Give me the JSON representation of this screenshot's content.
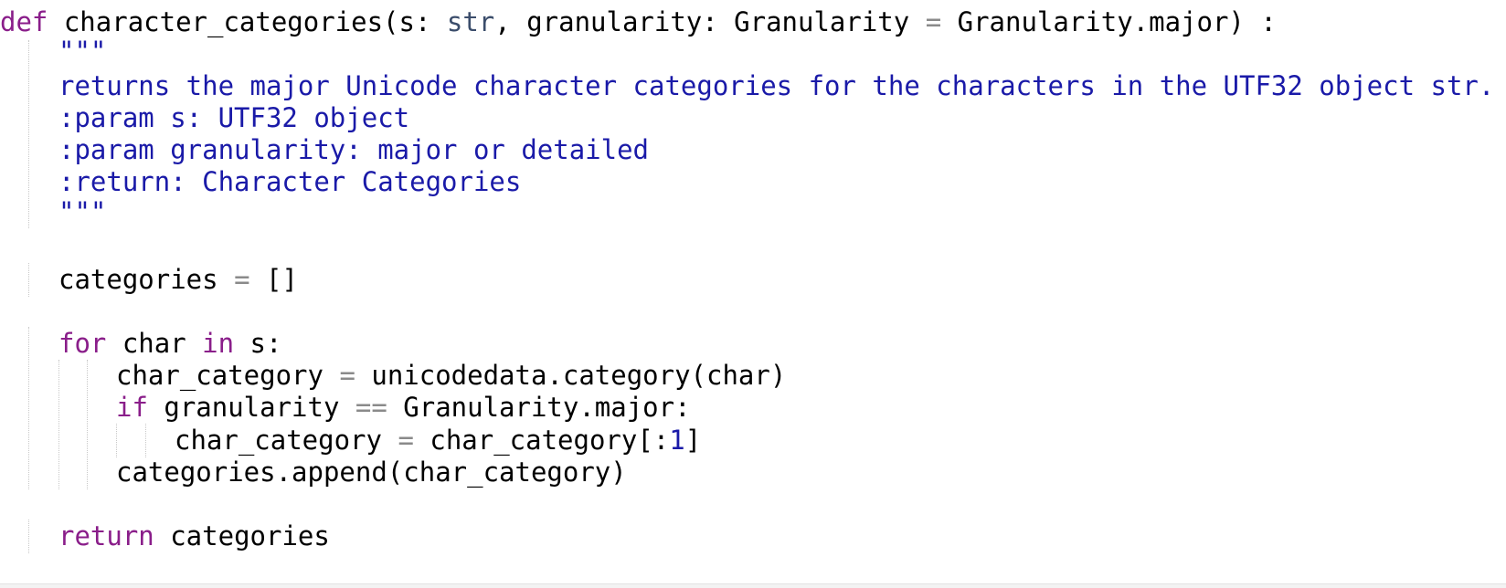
{
  "code": {
    "def_keyword": "def",
    "func_signature": " character_categories(s: ",
    "str_builtin": "str",
    "sig_part2": ", granularity: Granularity ",
    "sig_eq": "=",
    "sig_part3": " Granularity.major) :",
    "doc_quote_open": "\"\"\"",
    "doc_line1": "returns the major Unicode character categories for the characters in the UTF32 object str.",
    "doc_line2": ":param s: UTF32 object",
    "doc_line3": ":param granularity: major or detailed",
    "doc_line4": ":return: Character Categories",
    "doc_quote_close": "\"\"\"",
    "cat_name": "categories ",
    "cat_eq": "=",
    "cat_val": " []",
    "for_kw": "for",
    "for_mid": " char ",
    "in_kw": "in",
    "for_end": " s:",
    "cc_name": "char_category ",
    "cc_eq": "=",
    "cc_val": " unicodedata.category(char)",
    "if_kw": "if",
    "if_mid": " granularity ",
    "if_eq": "==",
    "if_end": " Granularity.major:",
    "slice_name": "char_category ",
    "slice_eq": "=",
    "slice_val": " char_category[:",
    "slice_num": "1",
    "slice_close": "]",
    "append_line": "categories.append(char_category)",
    "return_kw": "return",
    "return_val": " categories"
  },
  "colors": {
    "keyword": "#8a1e8a",
    "builtin": "#3b4d6b",
    "docstring": "#1a1aa8",
    "operator": "#8a8a8a",
    "number": "#1a1aa8"
  }
}
